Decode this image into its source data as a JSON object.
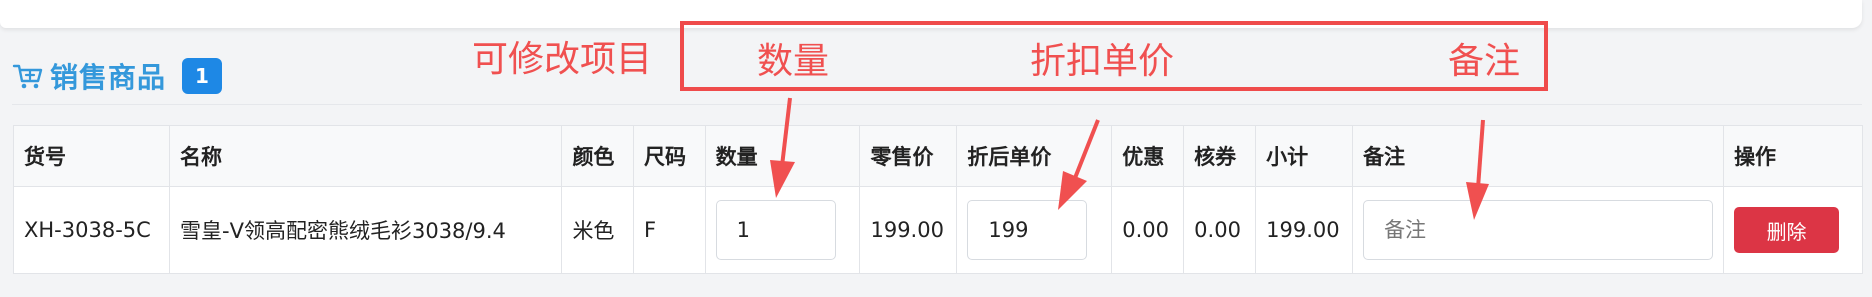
{
  "section": {
    "title": "销售商品",
    "count": "1"
  },
  "table": {
    "headers": [
      "货号",
      "名称",
      "颜色",
      "尺码",
      "数量",
      "零售价",
      "折后单价",
      "优惠",
      "核券",
      "小计",
      "备注",
      "操作"
    ],
    "row": {
      "sku": "XH-3038-5C",
      "name": "雪皇-V领高配密熊绒毛衫3038/9.4",
      "color": "米色",
      "size": "F",
      "quantity": "1",
      "retail_price": "199.00",
      "discount_price": "199",
      "discount": "0.00",
      "coupon": "0.00",
      "subtotal": "199.00",
      "remark_placeholder": "备注",
      "action_label": "删除"
    }
  },
  "annotation": {
    "editable_label": "可修改项目",
    "quantity_label": "数量",
    "discount_price_label": "折扣单价",
    "remark_label": "备注",
    "color": "#f05050"
  },
  "icons": {
    "cart": "cart-icon"
  }
}
